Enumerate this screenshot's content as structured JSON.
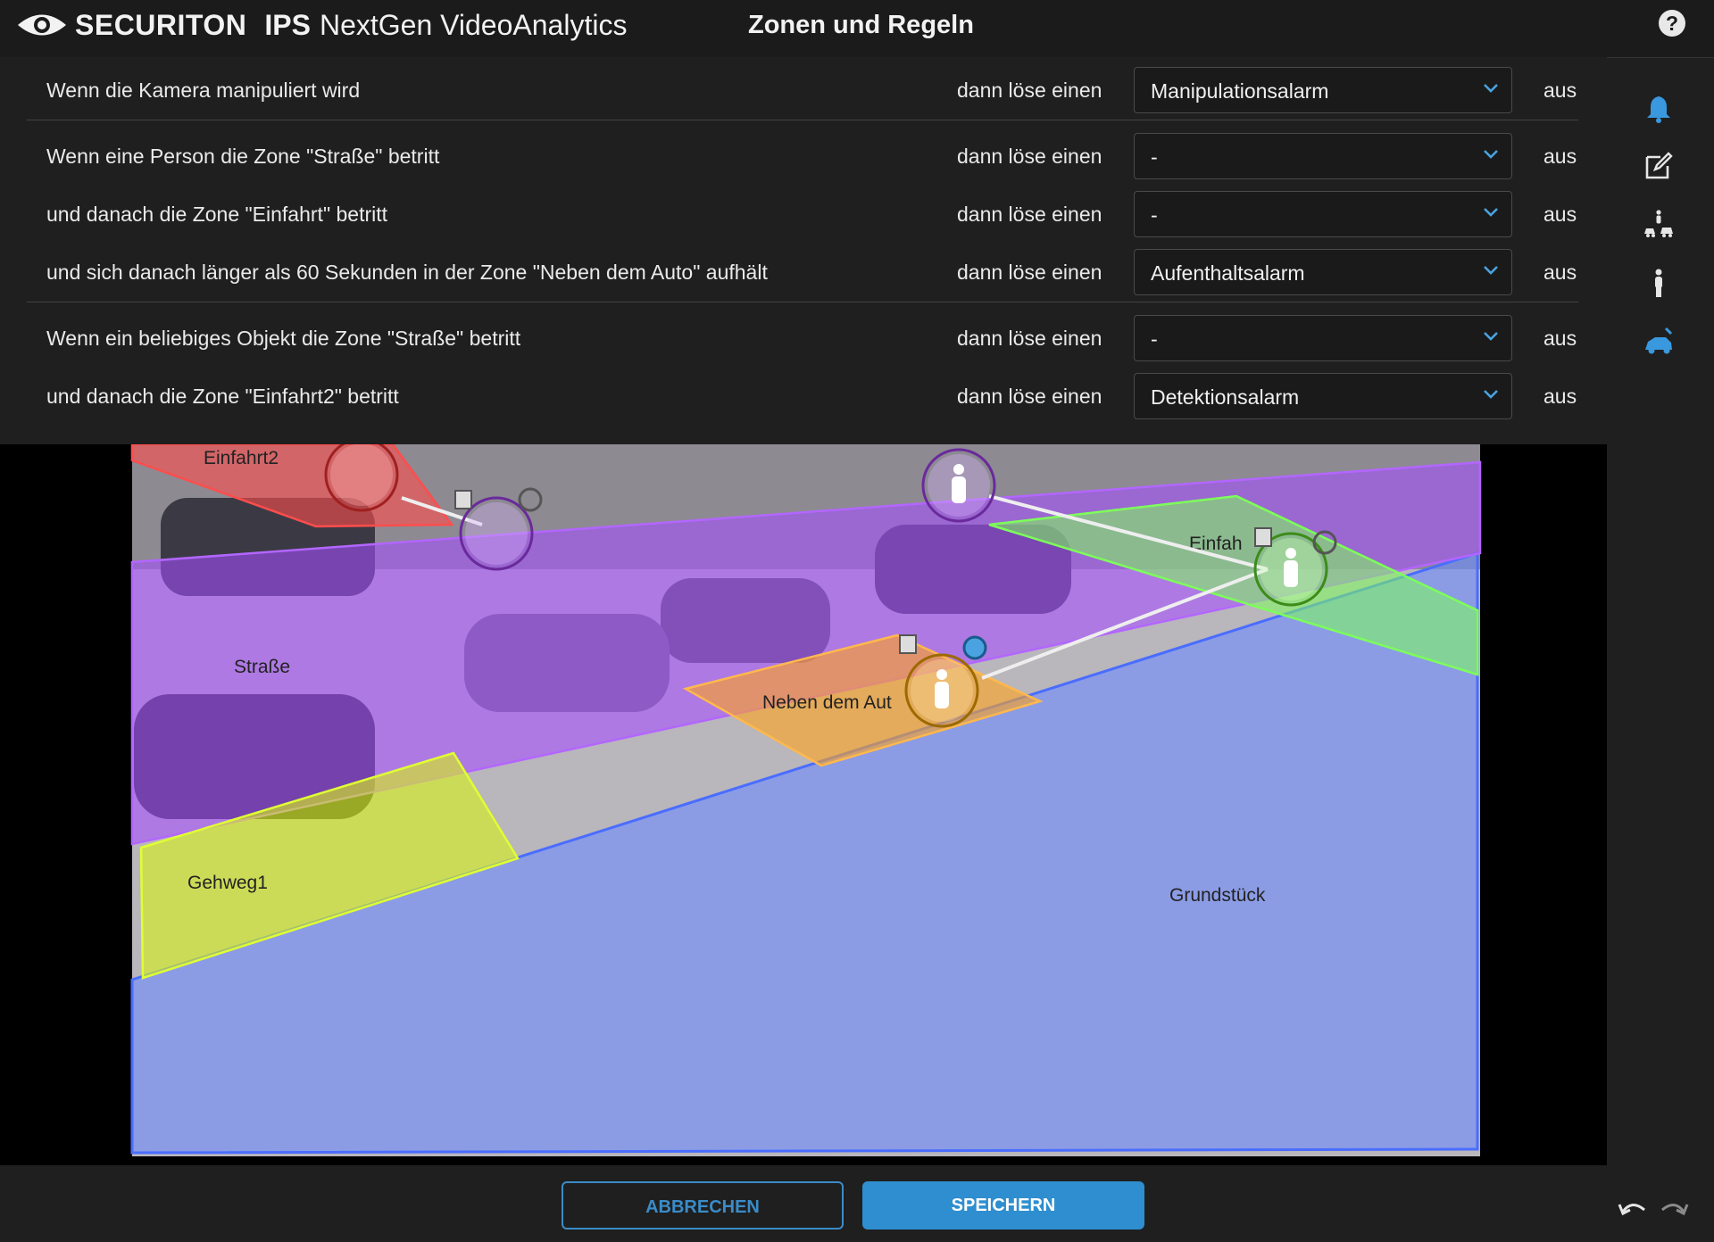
{
  "header": {
    "brand_primary": "SECURITON",
    "brand_product": "IPS",
    "brand_subtitle": "NextGen VideoAnalytics",
    "title": "Zonen und Regeln",
    "help_label": "?"
  },
  "rules": [
    {
      "condition": "Wenn die Kamera manipuliert wird",
      "action": "dann löse einen",
      "alarm": "Manipulationsalarm",
      "state": "aus"
    },
    {
      "condition": "Wenn eine Person die Zone \"Straße\" betritt",
      "action": "dann löse einen",
      "alarm": "-",
      "state": "aus"
    },
    {
      "condition": "und danach die Zone \"Einfahrt\" betritt",
      "action": "dann löse einen",
      "alarm": "-",
      "state": "aus"
    },
    {
      "condition": "und sich danach länger als 60 Sekunden in der Zone \"Neben dem Auto\" aufhält",
      "action": "dann löse einen",
      "alarm": "Aufenthaltsalarm",
      "state": "aus"
    },
    {
      "condition": "Wenn ein beliebiges Objekt die Zone \"Straße\" betritt",
      "action": "dann löse einen",
      "alarm": "-",
      "state": "aus"
    },
    {
      "condition": "und danach die Zone \"Einfahrt2\" betritt",
      "action": "dann löse einen",
      "alarm": "Detektionsalarm",
      "state": "aus"
    }
  ],
  "toolbar": {
    "icons": [
      "bell-icon",
      "edit-icon",
      "person-vehicle-icon",
      "person-icon",
      "vehicle-icon"
    ],
    "active": "vehicle-icon"
  },
  "zones": {
    "einfahrt2": "Einfahrt2",
    "strasse": "Straße",
    "einfahrt": "Einfah",
    "neben_dem_auto": "Neben dem Aut",
    "gehweg1": "Gehweg1",
    "grundstueck": "Grundstück"
  },
  "colors": {
    "accent": "#2e8ecf",
    "zone_red": "#ff4d4d",
    "zone_purple": "#a64dff",
    "zone_green": "#7dff5a",
    "zone_orange": "#ffa31a",
    "zone_yellow": "#d9f21a",
    "zone_blue": "#6f8dff"
  },
  "footer": {
    "cancel_label": "ABBRECHEN",
    "save_label": "SPEICHERN"
  }
}
